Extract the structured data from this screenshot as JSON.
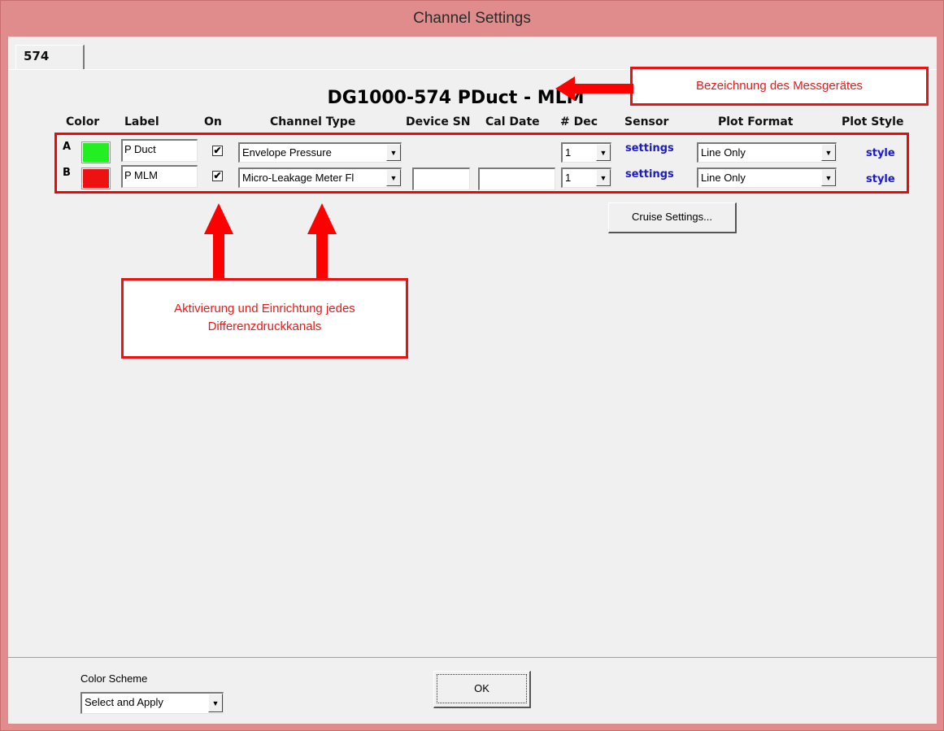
{
  "window": {
    "title": "Channel Settings"
  },
  "tab": {
    "label": "574"
  },
  "device": {
    "title": "DG1000-574 PDuct - MLM"
  },
  "columns": {
    "color": "Color",
    "label": "Label",
    "on": "On",
    "channel_type": "Channel Type",
    "device_sn": "Device SN",
    "cal_date": "Cal Date",
    "dec": "# Dec",
    "sensor": "Sensor",
    "plot_format": "Plot Format",
    "plot_style": "Plot Style"
  },
  "channels": [
    {
      "id": "A",
      "color": "#22ee22",
      "label": "P Duct",
      "on": true,
      "on_mark": "✔",
      "channel_type": "Envelope Pressure",
      "device_sn": "",
      "cal_date": "",
      "dec": "1",
      "sensor_link": "settings",
      "plot_format": "Line Only",
      "style_link": "style"
    },
    {
      "id": "B",
      "color": "#ee1111",
      "label": "P MLM",
      "on": true,
      "on_mark": "✔",
      "channel_type": "Micro-Leakage Meter Fl",
      "device_sn": "",
      "cal_date": "",
      "dec": "1",
      "sensor_link": "settings",
      "plot_format": "Line Only",
      "style_link": "style"
    }
  ],
  "cruise_button": "Cruise Settings...",
  "color_scheme": {
    "label": "Color Scheme",
    "value": "Select and Apply"
  },
  "ok_button": "OK",
  "annotations": {
    "device_callout": "Bezeichnung des Messgerätes",
    "channel_callout_line1": "Aktivierung und Einrichtung jedes",
    "channel_callout_line2": "Differenzdruckkanals"
  },
  "colors": {
    "annotation_red": "#ff0000",
    "link_blue": "#1a1acc",
    "titlebar": "#e08c8c"
  }
}
